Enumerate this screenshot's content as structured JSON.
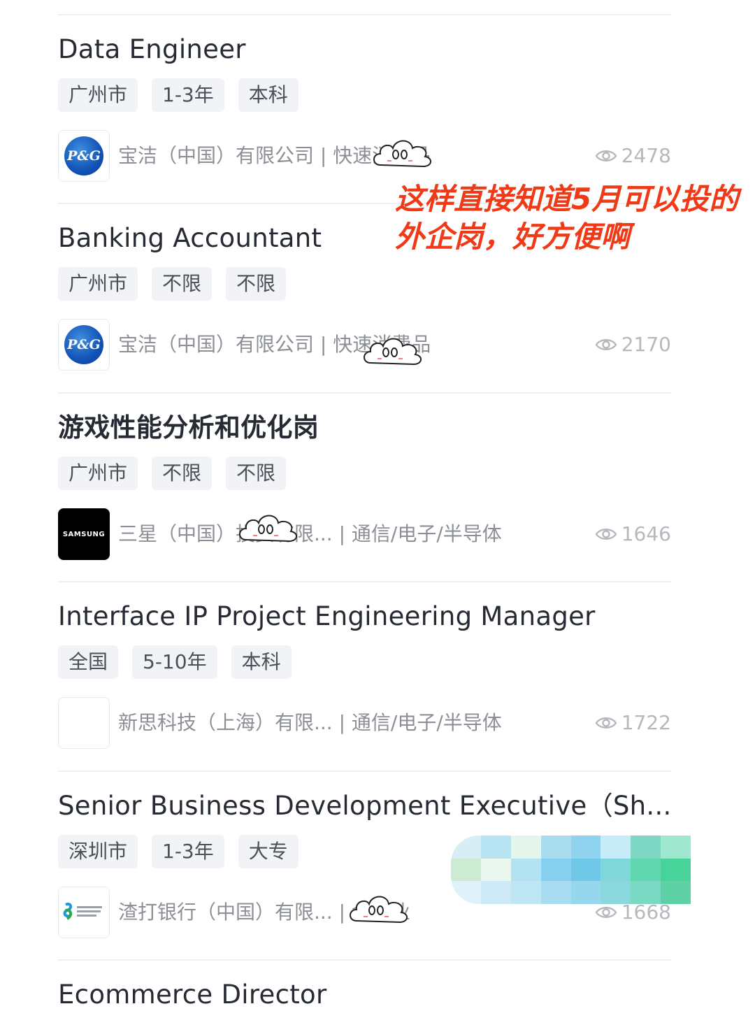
{
  "jobs": [
    {
      "title": "Data Engineer",
      "tags": [
        "广州市",
        "1-3年",
        "本科"
      ],
      "company": "宝洁（中国）有限公司 | 快速消费品",
      "views": "2478",
      "logo": "P&G"
    },
    {
      "title": "Banking Accountant",
      "tags": [
        "广州市",
        "不限",
        "不限"
      ],
      "company": "宝洁（中国）有限公司 | 快速消费品",
      "views": "2170",
      "logo": "P&G"
    },
    {
      "title": "游戏性能分析和优化岗",
      "tags": [
        "广州市",
        "不限",
        "不限"
      ],
      "company": "三星（中国）投资有限... | 通信/电子/半导体",
      "views": "1646",
      "logo": "SAMSUNG"
    },
    {
      "title": "Interface IP Project Engineering Manager",
      "tags": [
        "全国",
        "5-10年",
        "本科"
      ],
      "company": "新思科技（上海）有限... | 通信/电子/半导体",
      "views": "1722",
      "logo": ""
    },
    {
      "title": "Senior Business Development Executive（Sh...",
      "tags": [
        "深圳市",
        "1-3年",
        "大专"
      ],
      "company": "渣打银行（中国）有限... | 金融业",
      "views": "1668",
      "logo": "standard chartered 渣打银行"
    },
    {
      "title": "Ecommerce Director"
    }
  ],
  "annotation": {
    "line1": "这样直接知道5月可以投的",
    "line2": "外企岗，好方便啊"
  },
  "icons": {
    "views": "eye-icon",
    "sticker": "cloud-face-sticker"
  },
  "colors": {
    "annotation": "#f03a17",
    "tag_bg": "#f1f3f6",
    "muted_text": "#8c9096"
  }
}
